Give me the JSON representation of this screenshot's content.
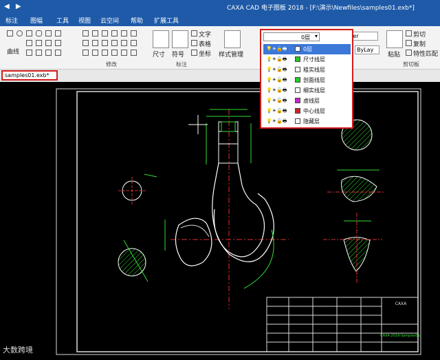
{
  "app": {
    "window_title": "CAXA CAD 电子图板 2018 - [F:\\演示\\Newfiles\\samples01.exb*]",
    "quick_access": [
      "◀",
      "▶"
    ]
  },
  "menu": [
    "标注",
    "图幅",
    "工具",
    "视图",
    "云空间",
    "帮助",
    "扩展工具"
  ],
  "ribbon": {
    "groups": [
      {
        "label": "曲线"
      },
      {
        "label": "修改"
      },
      {
        "label": "标注"
      },
      {
        "label": "剪切板"
      }
    ],
    "buttons": {
      "dimension": "尺寸",
      "symbol": "符号",
      "text": "文字",
      "table": "表格",
      "coordinate": "坐标",
      "style_manager": "样式管理",
      "paste": "粘贴",
      "cut": "剪切",
      "copy": "复制",
      "match_properties": "特性匹配"
    },
    "layer_selected": "0层",
    "bylayer_color": "ByLayer",
    "bylayer_linetype": "ByLay"
  },
  "file_tabs": [
    {
      "label": "samples01.exb*",
      "active": true
    }
  ],
  "layers": [
    {
      "name": "0层",
      "color": "#ffffff",
      "active": true
    },
    {
      "name": "尺寸线层",
      "color": "#22cc22",
      "active": false
    },
    {
      "name": "粗实线层",
      "color": "#ffffff",
      "active": false
    },
    {
      "name": "剖面线层",
      "color": "#22cc22",
      "active": false
    },
    {
      "name": "细实线层",
      "color": "#ffffff",
      "active": false
    },
    {
      "name": "虚线层",
      "color": "#cc22cc",
      "active": false
    },
    {
      "name": "中心线层",
      "color": "#cc2222",
      "active": false
    },
    {
      "name": "隐藏层",
      "color": "#ffffff",
      "active": false
    }
  ],
  "titleblock": {
    "company": "CAXA",
    "drawing_no": "CAXA 2019-Samples01"
  },
  "watermark": "大数跨境",
  "colors": {
    "title_bar": "#1e5aa8",
    "highlight": "#d21b1b",
    "cad_background": "#000000",
    "green_geometry": "#33dd33",
    "red_centerline": "#e03030"
  }
}
